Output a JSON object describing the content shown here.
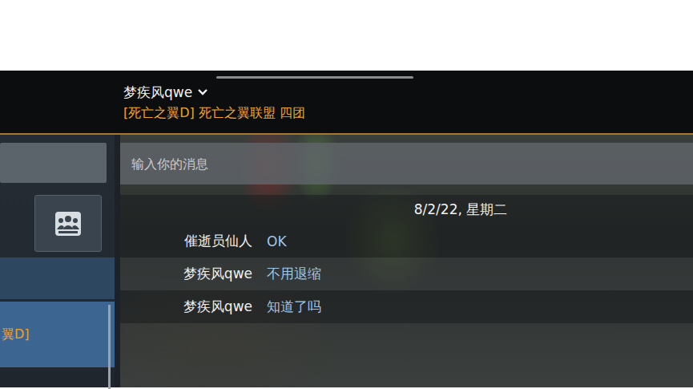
{
  "header": {
    "name": "梦疾风qwe",
    "clan": "[死亡之翼D] 死亡之翼联盟 四团"
  },
  "sidebar": {
    "items": [
      {
        "label": "翼D]",
        "selected": true
      }
    ]
  },
  "message_input": {
    "placeholder": "输入你的消息"
  },
  "date": "8/2/22, 星期二",
  "messages": [
    {
      "sender": "催逝员仙人",
      "text": "OK"
    },
    {
      "sender": "梦疾风qwe",
      "text": "不用退缩"
    },
    {
      "sender": "梦疾风qwe",
      "text": "知道了吗"
    }
  ]
}
